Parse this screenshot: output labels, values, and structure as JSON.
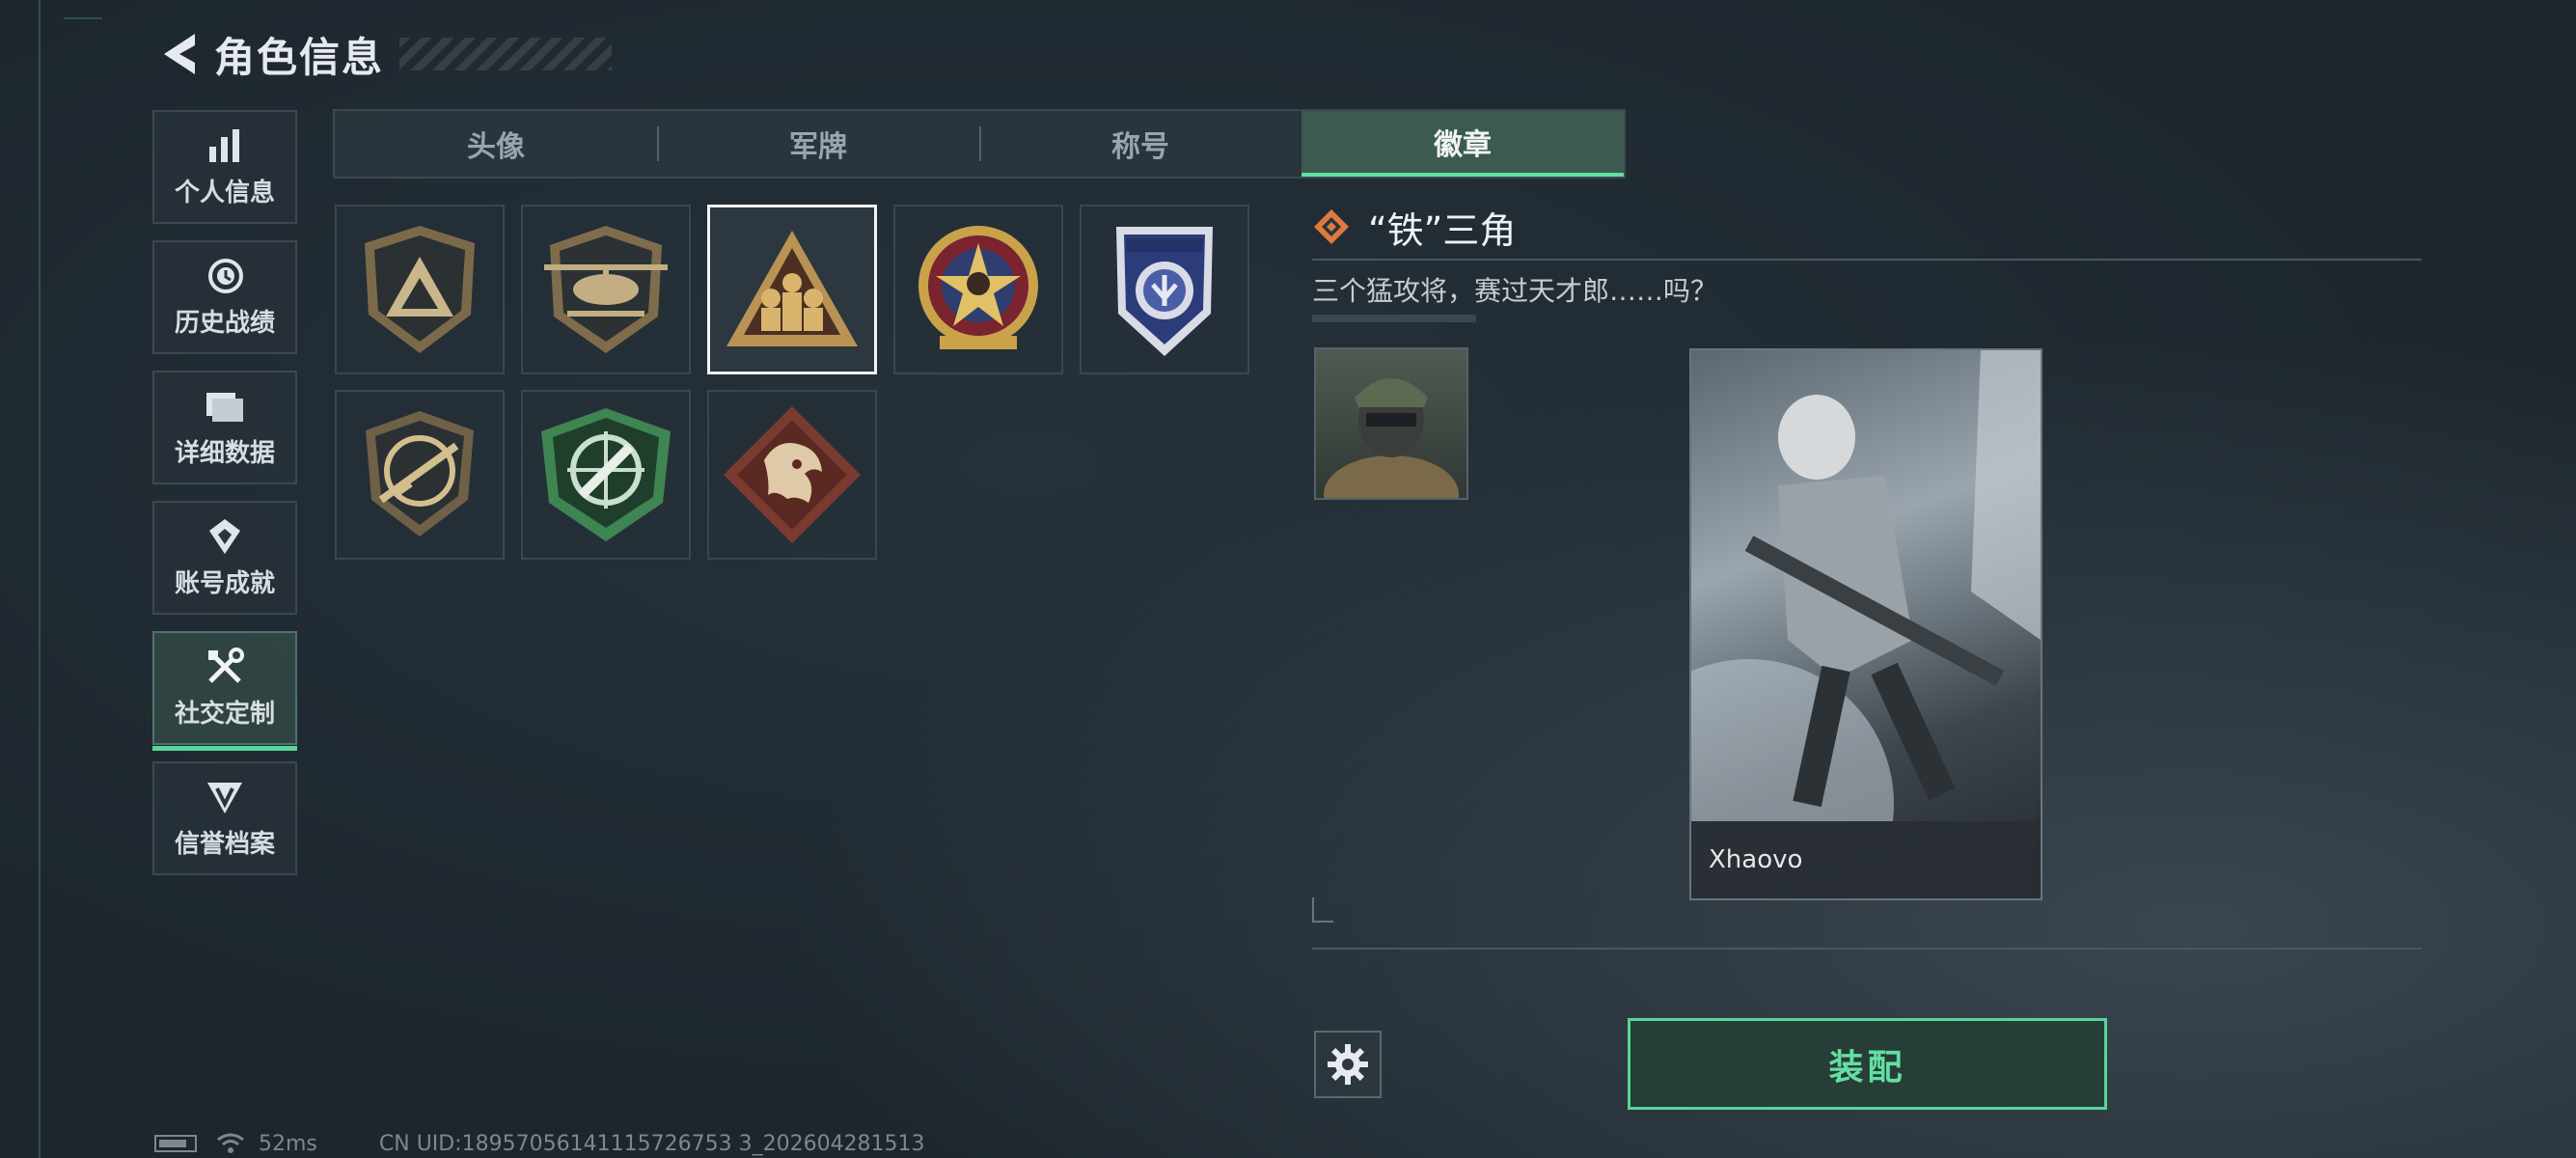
{
  "header": {
    "title": "角色信息",
    "back_icon": "chevron-left-icon"
  },
  "sidebar": {
    "items": [
      {
        "label": "个人信息",
        "icon": "bar-chart-icon"
      },
      {
        "label": "历史战绩",
        "icon": "clock-history-icon"
      },
      {
        "label": "详细数据",
        "icon": "folder-icon"
      },
      {
        "label": "账号成就",
        "icon": "achievement-icon"
      },
      {
        "label": "社交定制",
        "icon": "wrench-screwdriver-icon",
        "active": true
      },
      {
        "label": "信誉档案",
        "icon": "shield-v-icon"
      }
    ]
  },
  "tabs": [
    {
      "label": "头像"
    },
    {
      "label": "军牌"
    },
    {
      "label": "称号"
    },
    {
      "label": "徽章",
      "active": true
    }
  ],
  "badges": [
    {
      "icon": "triangle-shield-badge-icon"
    },
    {
      "icon": "helicopter-badge-icon"
    },
    {
      "icon": "iron-triangle-badge-icon",
      "selected": true
    },
    {
      "icon": "star-skull-badge-icon"
    },
    {
      "icon": "blue-wing-badge-icon"
    },
    {
      "icon": "rifle-badge-icon"
    },
    {
      "icon": "green-crosshair-badge-icon"
    },
    {
      "icon": "dragon-badge-icon"
    }
  ],
  "detail": {
    "name": "“铁”三角",
    "description": "三个猛攻将，赛过天才郎……吗？",
    "card_player_name": "Xhaovo"
  },
  "actions": {
    "equip_label": "装配",
    "settings_icon": "gear-icon"
  },
  "status": {
    "ping": "52ms",
    "uid": "CN UID:18957056141115726753 3_202604281513"
  },
  "colors": {
    "accent": "#5fe0a2",
    "background": "#1d262d",
    "highlight_orange": "#e07a3c"
  }
}
